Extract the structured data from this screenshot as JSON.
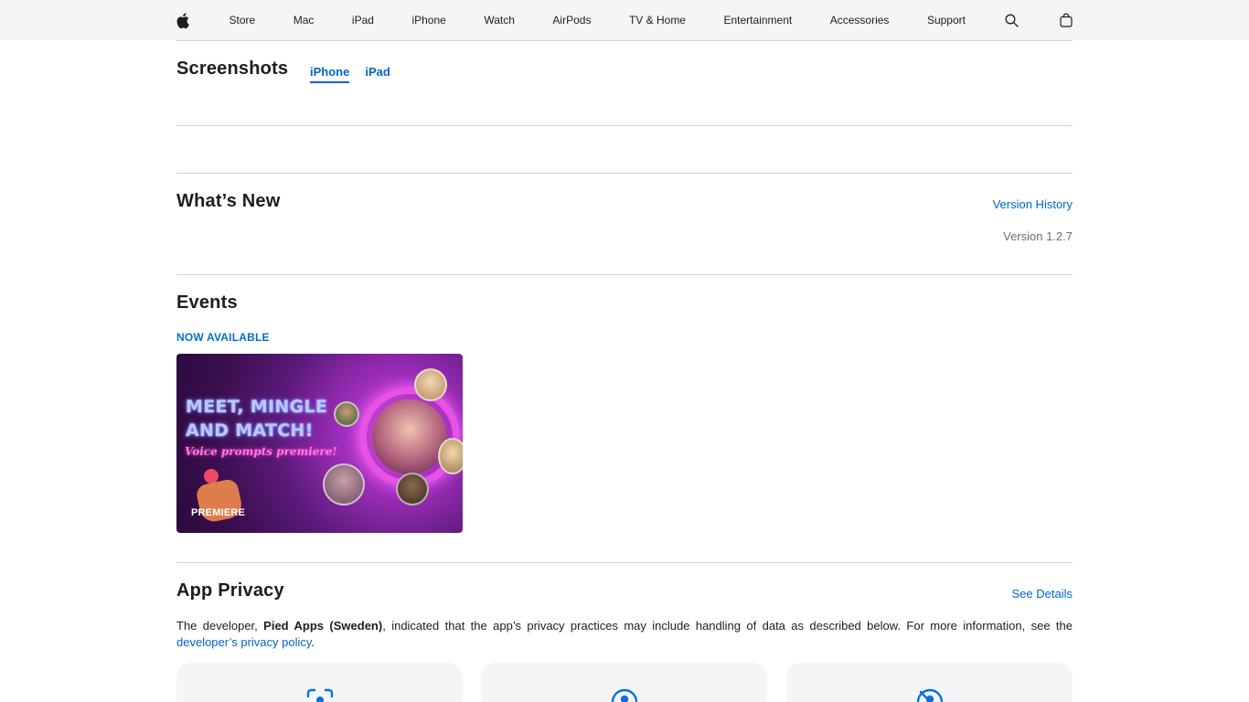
{
  "nav": {
    "items": [
      "Store",
      "Mac",
      "iPad",
      "iPhone",
      "Watch",
      "AirPods",
      "TV & Home",
      "Entertainment",
      "Accessories",
      "Support"
    ],
    "icons": [
      "apple-logo",
      "search-icon",
      "bag-icon"
    ]
  },
  "screenshots": {
    "title": "Screenshots",
    "tabs": [
      "iPhone",
      "iPad"
    ],
    "active_tab": "iPhone"
  },
  "whats_new": {
    "title": "What’s New",
    "version_history_link": "Version History",
    "version": "Version 1.2.7"
  },
  "events": {
    "title": "Events",
    "status": "NOW AVAILABLE",
    "card": {
      "headline_line1": "MEET, MINGLE",
      "headline_line2": "AND MATCH!",
      "subheadline": "Voice prompts premiere!",
      "badge": "PREMIERE"
    }
  },
  "privacy": {
    "title": "App Privacy",
    "see_details_link": "See Details",
    "text_before": "The developer, ",
    "developer_name": "Pied Apps (Sweden)",
    "text_after": ", indicated that the app’s privacy practices may include handling of data as described below. For more information, see the ",
    "policy_link": "developer’s privacy policy",
    "text_end": ".",
    "cards": [
      "tracking-icon",
      "linked-data-icon",
      "not-linked-data-icon"
    ]
  },
  "colors": {
    "link": "#0066cc",
    "nav_bg": "#f5f5f7",
    "text": "#1d1d1f",
    "secondary_text": "#6e6e73",
    "divider": "#d2d2d7"
  }
}
